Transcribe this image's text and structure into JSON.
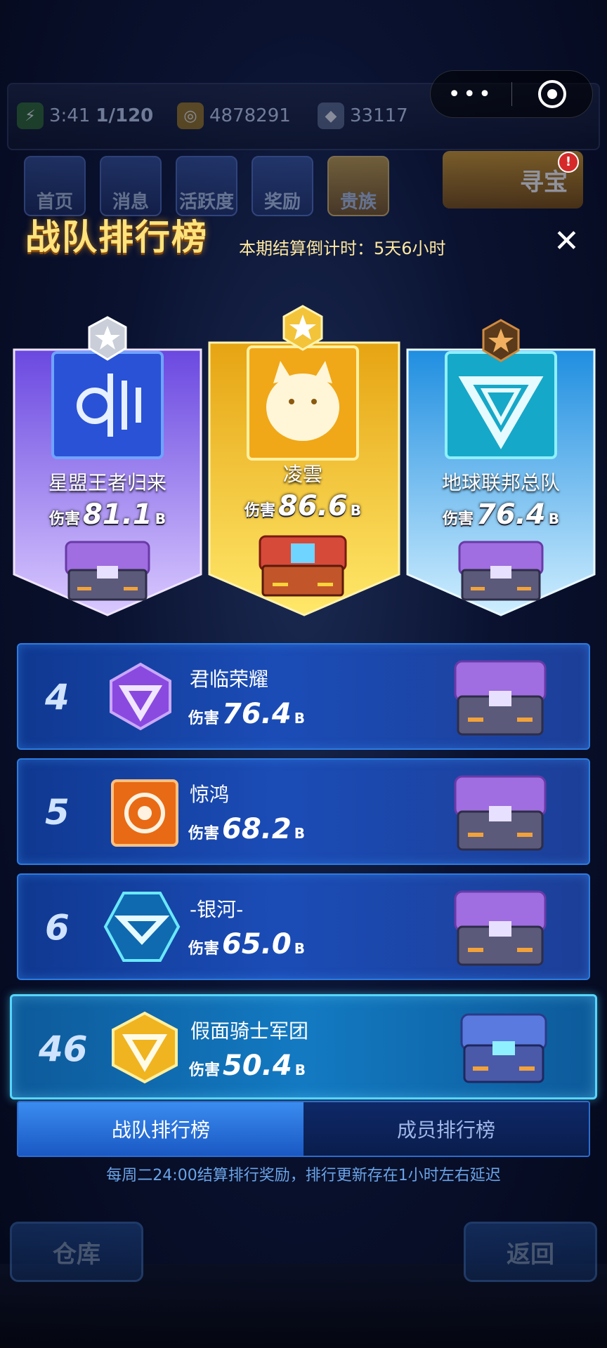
{
  "status": {
    "energy": "3:41",
    "energy_count": "1/120",
    "coins": "4878291",
    "gems": "33117"
  },
  "nav": [
    "首页",
    "消息",
    "活跃度",
    "奖励",
    "贵族"
  ],
  "treasure": {
    "label": "寻宝",
    "badge": "!"
  },
  "header": {
    "title": "战队排行榜",
    "countdown_label": "本期结算倒计时：",
    "countdown_value": "5天6小时",
    "close": "✕"
  },
  "podium": [
    {
      "rank": 2,
      "name": "星盟王者归来",
      "damage_label": "伤害",
      "damage": "81.1",
      "unit": "B"
    },
    {
      "rank": 1,
      "name": "凌雲",
      "damage_label": "伤害",
      "damage": "86.6",
      "unit": "B"
    },
    {
      "rank": 3,
      "name": "地球联邦总队",
      "damage_label": "伤害",
      "damage": "76.4",
      "unit": "B"
    }
  ],
  "list": [
    {
      "rank": "4",
      "name": "君临荣耀",
      "damage_label": "伤害",
      "damage": "76.4",
      "unit": "B"
    },
    {
      "rank": "5",
      "name": "惊鸿",
      "damage_label": "伤害",
      "damage": "68.2",
      "unit": "B"
    },
    {
      "rank": "6",
      "name": "-银河-",
      "damage_label": "伤害",
      "damage": "65.0",
      "unit": "B"
    },
    {
      "rank": "46",
      "name": "假面骑士军团",
      "damage_label": "伤害",
      "damage": "50.4",
      "unit": "B"
    }
  ],
  "tabs": {
    "team": "战队排行榜",
    "member": "成员排行榜"
  },
  "note": "每周二24:00结算排行奖励，排行更新存在1小时左右延迟",
  "bottom": {
    "left": "仓库",
    "right": "返回"
  },
  "colors": {
    "gold": "#ffe37a",
    "purple": "#8a5cf0",
    "cyan": "#3fb6ff",
    "row_blue": "#1b4cb6"
  }
}
